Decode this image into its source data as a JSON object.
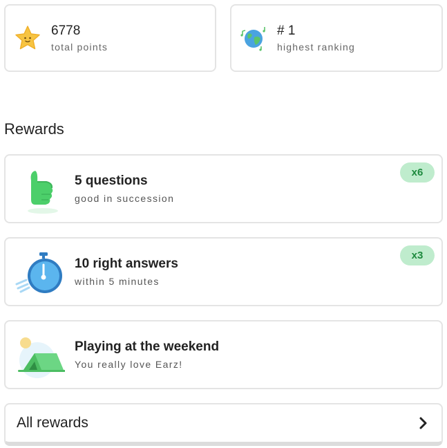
{
  "stats": {
    "points": {
      "value": "6778",
      "label": "total points",
      "icon": "star-icon"
    },
    "ranking": {
      "value": "# 1",
      "label": "highest ranking",
      "icon": "globe-music-icon"
    }
  },
  "rewards_title": "Rewards",
  "rewards": [
    {
      "title": "5 questions",
      "subtitle": "good in succession",
      "badge": "x6",
      "icon": "thumbs-up-icon"
    },
    {
      "title": "10 right answers",
      "subtitle": "within 5 minutes",
      "badge": "x3",
      "icon": "stopwatch-icon"
    },
    {
      "title": "Playing at the weekend",
      "subtitle": "You really love Earz!",
      "badge": "",
      "icon": "tent-icon"
    }
  ],
  "all_rewards": {
    "label": "All rewards",
    "icon": "chevron-right-icon"
  },
  "colors": {
    "badge_bg": "#bfeccd",
    "badge_text": "#1e8a3e",
    "accent_green": "#4ccf6a"
  }
}
